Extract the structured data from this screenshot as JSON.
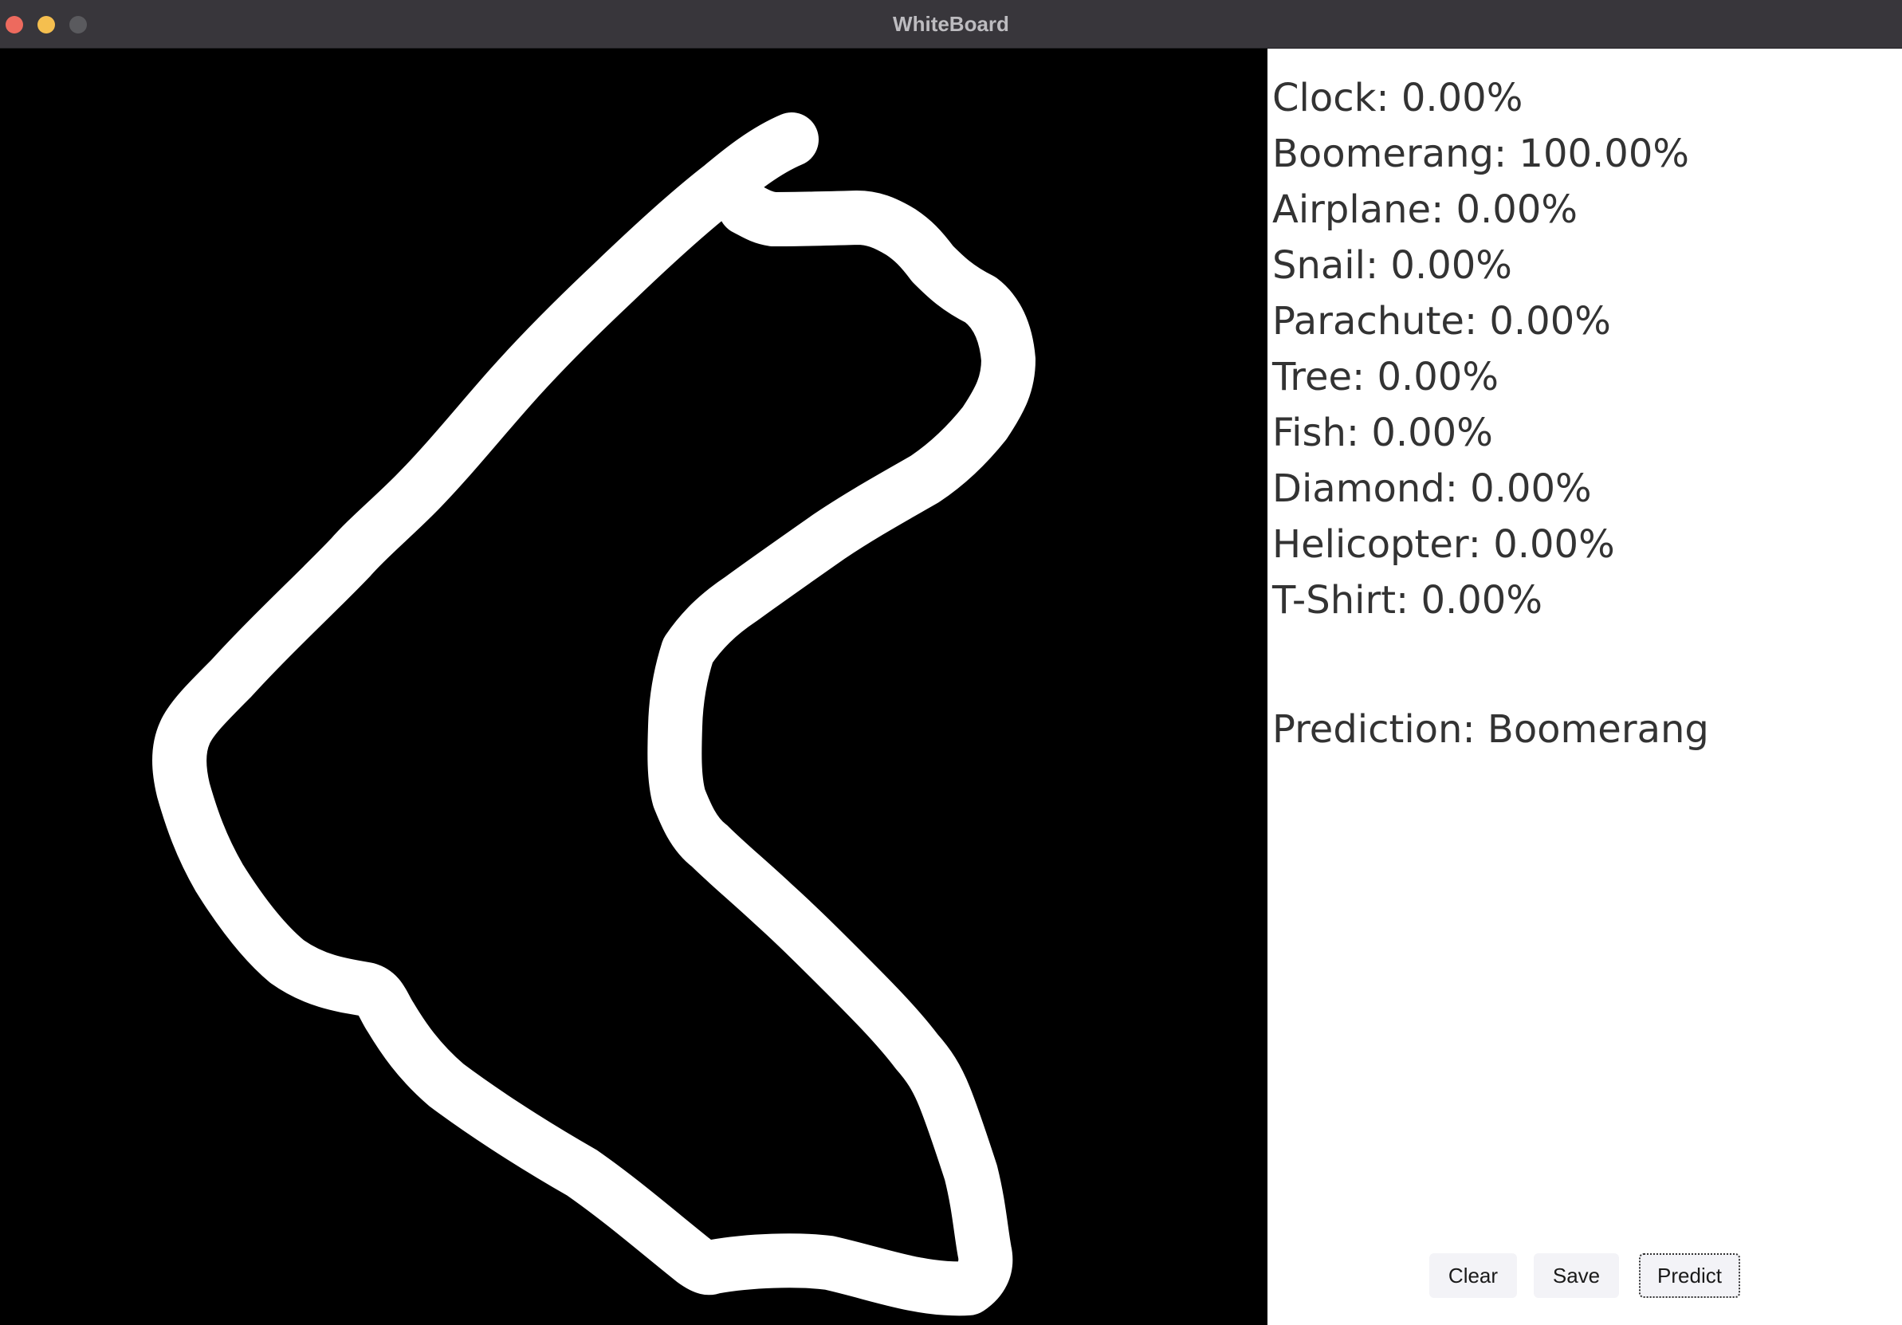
{
  "window": {
    "title": "WhiteBoard"
  },
  "probabilities": [
    {
      "label": "Clock: 0.00%"
    },
    {
      "label": "Boomerang: 100.00%"
    },
    {
      "label": "Airplane: 0.00%"
    },
    {
      "label": "Snail: 0.00%"
    },
    {
      "label": "Parachute: 0.00%"
    },
    {
      "label": "Tree: 0.00%"
    },
    {
      "label": "Fish: 0.00%"
    },
    {
      "label": "Diamond: 0.00%"
    },
    {
      "label": "Helicopter: 0.00%"
    },
    {
      "label": "T-Shirt: 0.00%"
    }
  ],
  "prediction": "Prediction: Boomerang",
  "buttons": {
    "clear": "Clear",
    "save": "Save",
    "predict": "Predict"
  },
  "colors": {
    "canvas_background": "#000000",
    "stroke": "#ffffff",
    "titlebar": "#38363b",
    "text": "#333333"
  }
}
